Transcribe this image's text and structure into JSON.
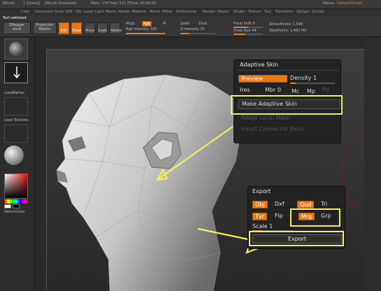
{
  "topbar": {
    "app": "ZBrush",
    "version": "1.1[Ivory]",
    "doc": "ZBrush Document",
    "stats": "Mem: 174  Free: 511  ZTime: 00:00:03",
    "menu": "Menus",
    "script": "DefaultZScript"
  },
  "menubar": {
    "items": [
      "Color",
      "Document",
      "Draw",
      "Edit",
      "File",
      "Layer",
      "Light",
      "Macro",
      "Marker",
      "Material",
      "Movie",
      "Picker",
      "Preferences",
      "Render",
      "Stencil",
      "Stroke",
      "Texture",
      "Tool",
      "Transform",
      "Zplugin",
      "Zscript"
    ]
  },
  "toolbar": {
    "note": "Tool switched",
    "brush": "ZMapper",
    "rev": "rev-E",
    "projection": "Projection",
    "projection2": "Master",
    "edit": "Edit",
    "draw": "Draw",
    "move": "Move",
    "scale": "Scale",
    "rotate": "Rotate",
    "mrgb": "Mrgb",
    "rgb": "Rgb",
    "m": "M",
    "zadd": "Zadd",
    "zsub": "Zsub",
    "rgb_intensity": "Rgb Intensity 100",
    "z_intensity": "Z Intensity 25",
    "focal_shift": "Focal Shift 0",
    "draw_size": "Draw Size 64",
    "active_points": "ActivePoints: 1,548",
    "total_points": "TotalPoints: 1.482 Mil"
  },
  "leftcol": {
    "label1": "LoadAlphas",
    "label2": "Load Textures",
    "label3": "SwitchColor"
  },
  "adaptive": {
    "title": "Adaptive Skin",
    "preview": "Preview",
    "density": "Density 1",
    "ires": "Ires",
    "mbr": "Mbr 0",
    "mc": "Mc",
    "mp": "Mp",
    "pd": "Pd",
    "make": "Make Adaptive Skin",
    "unused1": "Adapt Local Mesh",
    "unused2": "Insert Connector Mesh"
  },
  "export": {
    "title": "Export",
    "obj": "Obj",
    "dxf": "Dxf",
    "qud": "Qud",
    "tri": "Tri",
    "txr": "Txr",
    "flp": "Flp",
    "mrg": "Mrg",
    "grp": "Grp",
    "scale": "Scale 1",
    "button": "Export"
  },
  "colors": {
    "accent": "#e87818",
    "highlight": "#f0f060",
    "background": "#2a2a2a"
  }
}
